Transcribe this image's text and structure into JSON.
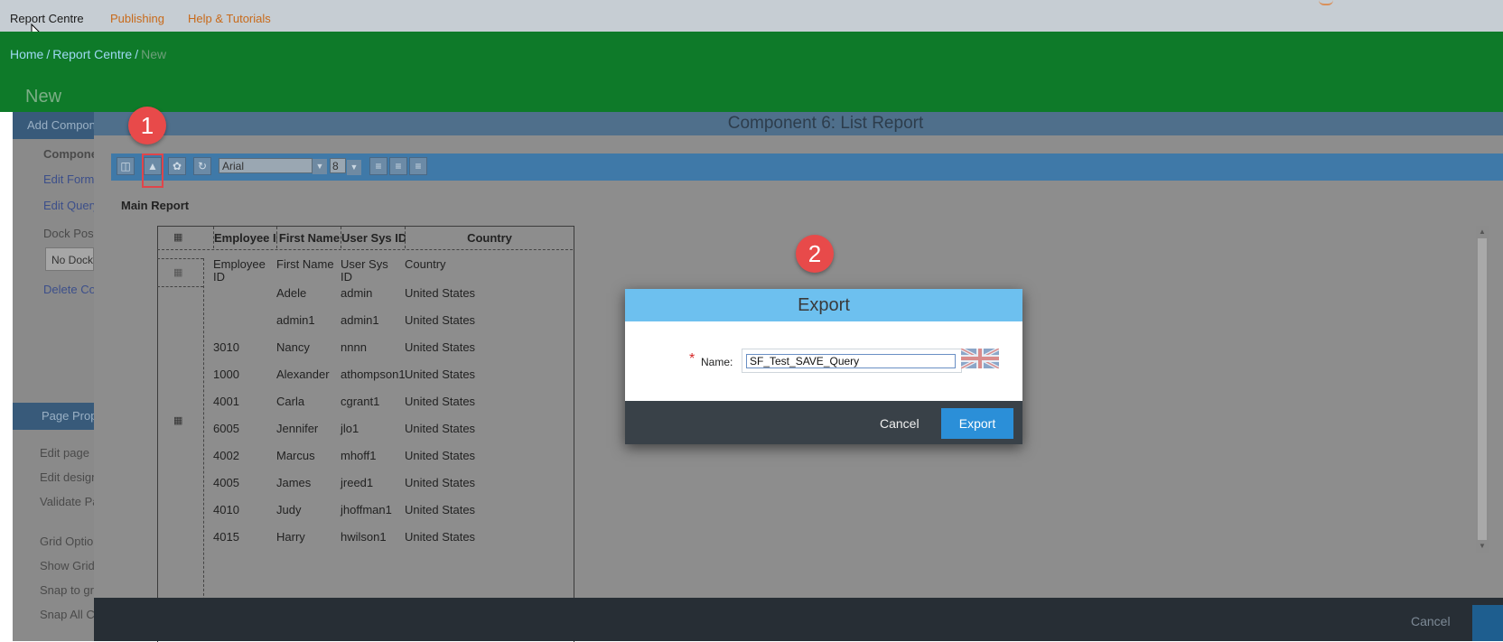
{
  "topnav": {
    "items": [
      "Report Centre",
      "Publishing",
      "Help & Tutorials"
    ]
  },
  "breadcrumb": {
    "home": "Home",
    "sep": "/",
    "report_centre": "Report Centre",
    "current": "New"
  },
  "page_title": "New",
  "left_panel": {
    "add_component": "Add Component",
    "items": [
      "Component",
      "Edit Format",
      "Edit Query"
    ],
    "dock_label": "Dock Position",
    "dock_value": "No Docking",
    "delete": "Delete Component",
    "page_props": "Page Properties",
    "page_items": [
      "Edit page",
      "Edit design",
      "Validate Page"
    ],
    "grid_items": [
      "Grid Options",
      "Show Grid",
      "Snap to grid",
      "Snap All Components"
    ]
  },
  "main_dialog": {
    "title": "Component 6: List Report",
    "main_report_label": "Main Report",
    "toolbar": {
      "font": "Arial",
      "font_size": "8"
    },
    "headers": [
      "Employee ID",
      "First Name",
      "User Sys ID",
      "Country"
    ],
    "field_row": [
      "Employee ID",
      "First Name",
      "User Sys ID",
      "Country"
    ],
    "rows": [
      [
        "",
        "Adele",
        "admin",
        "United States"
      ],
      [
        "",
        "admin1",
        "admin1",
        "United States"
      ],
      [
        "3010",
        "Nancy",
        "nnnn",
        "United States"
      ],
      [
        "1000",
        "Alexander",
        "athompson1",
        "United States"
      ],
      [
        "4001",
        "Carla",
        "cgrant1",
        "United States"
      ],
      [
        "6005",
        "Jennifer",
        "jlo1",
        "United States"
      ],
      [
        "4002",
        "Marcus",
        "mhoff1",
        "United States"
      ],
      [
        "4005",
        "James",
        "jreed1",
        "United States"
      ],
      [
        "4010",
        "Judy",
        "jhoffman1",
        "United States"
      ],
      [
        "4015",
        "Harry",
        "hwilson1",
        "United States"
      ]
    ],
    "cancel_label": "Cancel"
  },
  "annotations": {
    "badge1": "1",
    "badge2": "2"
  },
  "export_modal": {
    "title": "Export",
    "required_marker": "*",
    "name_label": "Name:",
    "name_value": "SF_Test_SAVE_Query",
    "cancel_label": "Cancel",
    "export_label": "Export"
  },
  "colors": {
    "green_header": "#0e7a29",
    "modal_header": "#6dc0ef",
    "primary_button": "#2b8fd8",
    "badge": "#e84a4a"
  }
}
